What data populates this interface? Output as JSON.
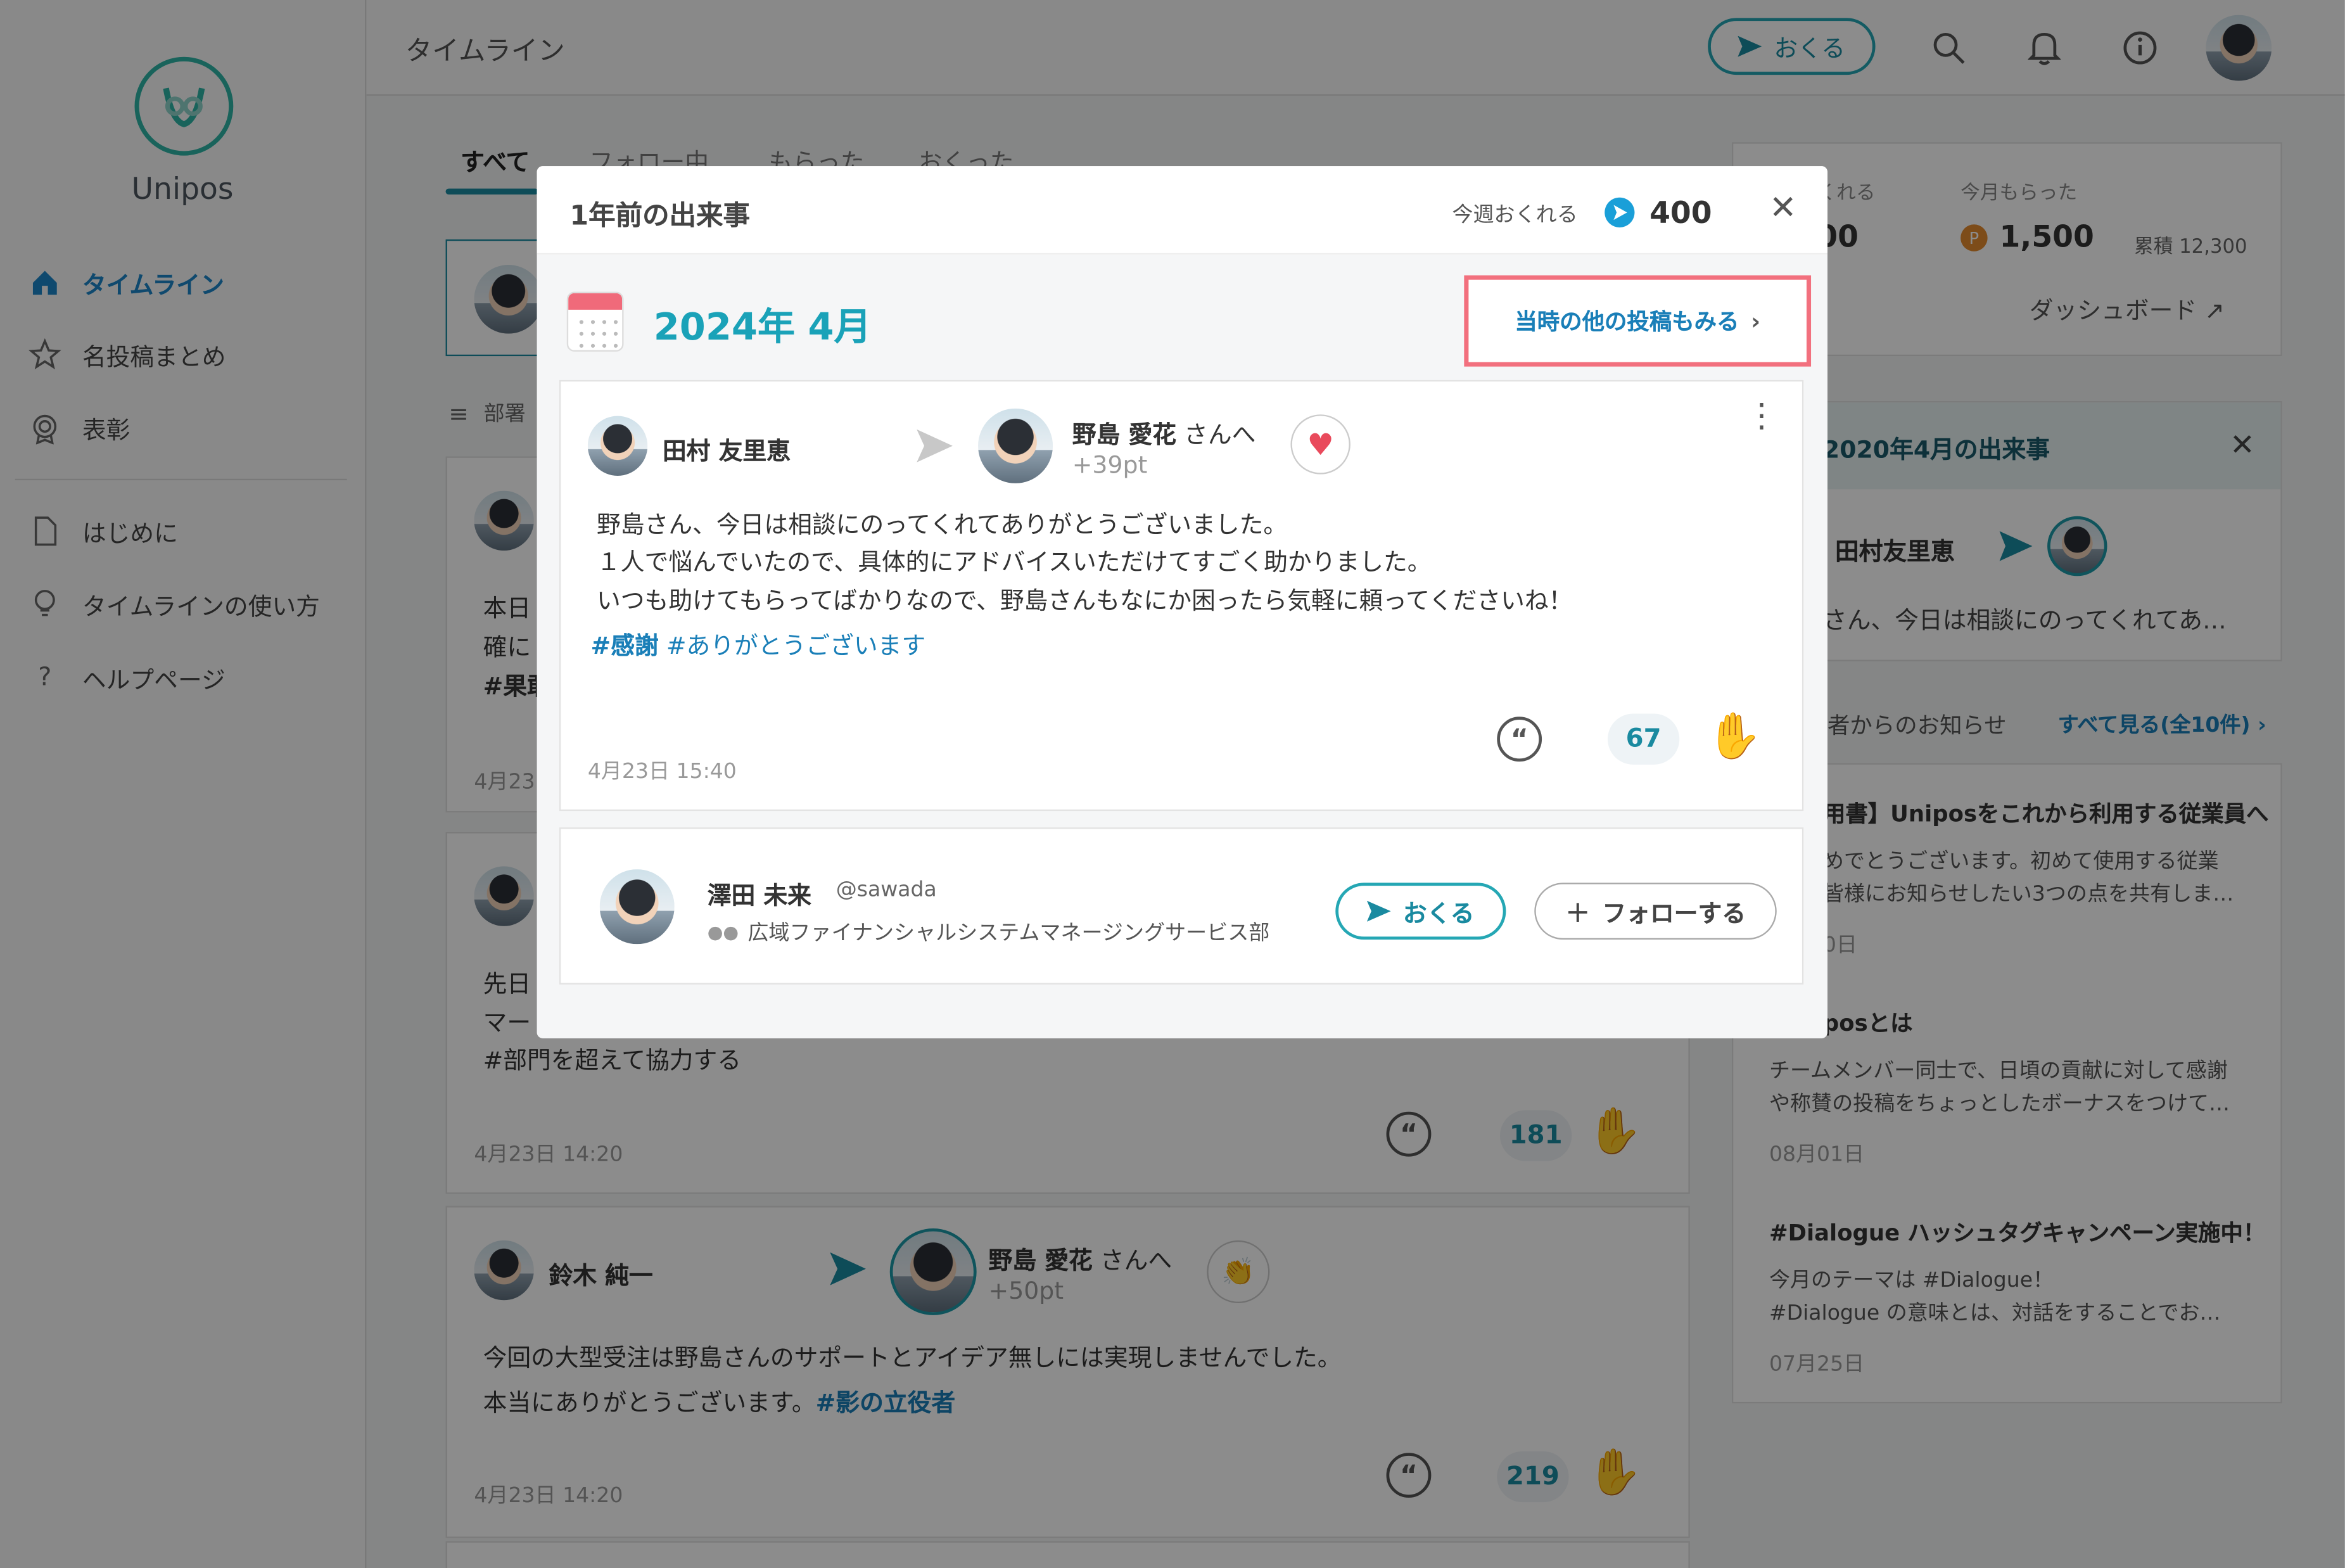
{
  "app": {
    "name": "Unipos"
  },
  "sidebar": {
    "items": [
      {
        "label": "タイムライン",
        "icon": "home-icon",
        "active": true
      },
      {
        "label": "名投稿まとめ",
        "icon": "star-icon",
        "active": false
      },
      {
        "label": "表彰",
        "icon": "award-icon",
        "active": false
      },
      {
        "label": "はじめに",
        "icon": "document-icon",
        "active": false
      },
      {
        "label": "タイムラインの使い方",
        "icon": "lightbulb-icon",
        "active": false
      },
      {
        "label": "ヘルプページ",
        "icon": "question-icon",
        "active": false
      }
    ]
  },
  "header": {
    "title": "タイムライン",
    "send_label": "おくる"
  },
  "tabs": [
    {
      "label": "すべて",
      "active": true
    },
    {
      "label": "フォロー中"
    },
    {
      "label": "もらった"
    },
    {
      "label": "おくった"
    }
  ],
  "filter": {
    "label": "部署"
  },
  "stats": {
    "can_send_label": "くれる",
    "can_send_value": "400",
    "received_label": "今月もらった",
    "received_value": "1,500",
    "total_label": "累積 12,300",
    "dashboard_link": "ダッシュボード"
  },
  "memory_panel": {
    "title": "2020年4月の出来事",
    "sender": "田村友里恵",
    "preview": "さん、今日は相談にのってくれてあ…"
  },
  "announcements": {
    "header": "者からのお知らせ",
    "see_all": "すべて見る(全10件)",
    "items": [
      {
        "title": "用書】Uniposをこれから利用する従業員へ",
        "line1": "めでとうございます。初めて使用する従業",
        "line2": "皆様にお知らせしたい3つの点を共有しま…",
        "date": "0日"
      },
      {
        "title": "posとは",
        "line1": "チームメンバー同士で、日頃の貢献に対して感謝",
        "line2": "や称賛の投稿をちょっとしたボーナスをつけて…",
        "date": "08月01日"
      },
      {
        "title": "#Dialogue ハッシュタグキャンペーン実施中！",
        "line1": "今月のテーマは #Dialogue！",
        "line2": "#Dialogue の意味とは、対話をすることでお…",
        "date": "07月25日"
      }
    ]
  },
  "feed": [
    {
      "line1": "本日",
      "line2": "確に",
      "hashtag": "#果敢",
      "date": "4月23"
    },
    {
      "line1": "先日",
      "line2": "マー",
      "hashtag": "#部門を超えて協力する",
      "date": "4月23日 14:20",
      "claps": "181"
    },
    {
      "sender": "鈴木 純一",
      "recipient": "野島 愛花",
      "recipient_suffix": "さんへ",
      "points": "+50pt",
      "line1": "今回の大型受注は野島さんのサポートとアイデア無しには実現しませんでした。",
      "line2": "本当にありがとうございます。",
      "hashtag": "#影の立役者",
      "date": "4月23日 14:20",
      "claps": "219"
    }
  ],
  "modal": {
    "title": "1年前の出来事",
    "weekly_label": "今週おくれる",
    "weekly_value": "400",
    "date_heading": "2024年 4月",
    "see_more": "当時の他の投稿もみる",
    "post": {
      "sender": "田村 友里恵",
      "recipient": "野島 愛花",
      "recipient_suffix": "さんへ",
      "points": "+39pt",
      "lines": [
        "野島さん、今日は相談にのってくれてありがとうございました。",
        "１人で悩んでいたので、具体的にアドバイスいただけてすごく助かりました。",
        "いつも助けてもらってばかりなので、野島さんもなにか困ったら気軽に頼ってくださいね！"
      ],
      "hashtag_bold": "#感謝",
      "hashtag": "#ありがとうございます",
      "date": "4月23日 15:40",
      "claps": "67"
    },
    "user": {
      "name": "澤田 未来",
      "handle": "@sawada",
      "dept": "広域ファイナンシャルシステムマネージングサービス部",
      "send_label": "おくる",
      "follow_label": "フォローする"
    }
  },
  "colors": {
    "accent": "#1a8aa0",
    "link": "#1a7fb8",
    "highlight": "#f2707e"
  }
}
